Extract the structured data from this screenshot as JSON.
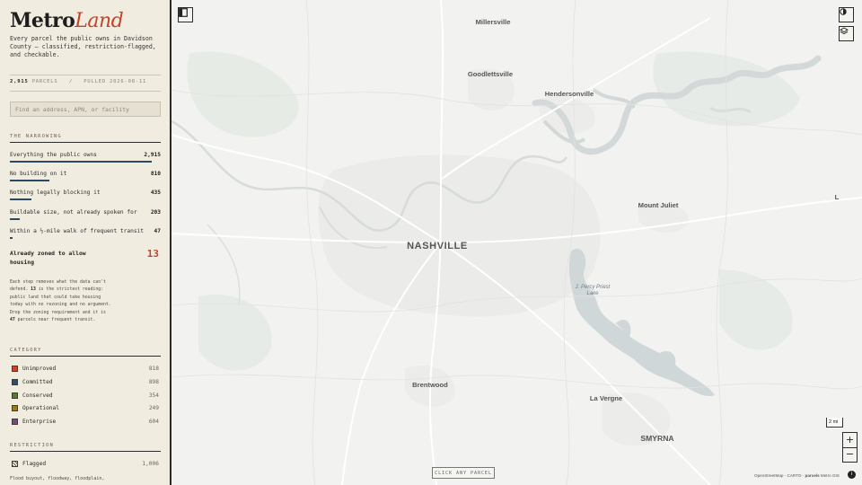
{
  "brand": {
    "part1": "Metro",
    "part2": "Land"
  },
  "tagline": "Every parcel the public owns in Davidson County — classified, restriction-flagged, and checkable.",
  "stats": {
    "count": "2,915",
    "count_label": "PARCELS",
    "separator": "/",
    "pulled": "PULLED 2026-08-11"
  },
  "search": {
    "placeholder": "Find an address, APN, or facility"
  },
  "narrowing": {
    "heading": "THE NARROWING",
    "steps": [
      {
        "label": "Everything the public owns",
        "count": "2,915",
        "fraction": 1.0
      },
      {
        "label": "No building on it",
        "count": "810",
        "fraction": 0.278
      },
      {
        "label": "Nothing legally blocking it",
        "count": "435",
        "fraction": 0.149
      },
      {
        "label": "Buildable size, not already spoken for",
        "count": "203",
        "fraction": 0.07
      },
      {
        "label": "Within a ½-mile walk of frequent transit",
        "count": "47",
        "fraction": 0.016
      }
    ],
    "final": {
      "label": "Already zoned to allow housing",
      "count": "13"
    },
    "note": {
      "part1": "Each step removes what the data can't defend.",
      "n1": "13",
      "part2": "is the strictest reading: public land that could take housing today with no rezoning and no argument. Drop the zoning requirement and it is",
      "n2": "47",
      "part3": "parcels near frequent transit."
    }
  },
  "category": {
    "heading": "CATEGORY",
    "items": [
      {
        "label": "Unimproved",
        "count": "818",
        "color": "#c9452b"
      },
      {
        "label": "Committed",
        "count": "898",
        "color": "#2f4f6f"
      },
      {
        "label": "Conserved",
        "count": "354",
        "color": "#5a7a3c"
      },
      {
        "label": "Operational",
        "count": "249",
        "color": "#9a7a24"
      },
      {
        "label": "Enterprise",
        "count": "604",
        "color": "#7a4a7e"
      }
    ]
  },
  "restriction": {
    "heading": "RESTRICTION",
    "flagged_label": "Flagged",
    "flagged_count": "1,006",
    "footnote": "Flood buyout, floodway, floodplain,"
  },
  "map": {
    "places": {
      "millersville": "Millersville",
      "goodlettsville": "Goodlettsville",
      "hendersonville": "Hendersonville",
      "mount_juliet": "Mount Juliet",
      "nashville": "NASHVILLE",
      "percy_priest_1": "J. Percy Priest",
      "percy_priest_2": "Lake",
      "brentwood": "Brentwood",
      "la_vergne": "La Vergne",
      "smyrna": "SMYRNA",
      "edge_letter": "L"
    },
    "scale_label": "2 mi",
    "zoom_in": "+",
    "zoom_out": "−",
    "hint": "CLICK ANY PARCEL",
    "attribution": {
      "osm": "OpenStreetMap",
      "carto": "CARTO",
      "sep": "·",
      "parcels": "parcels",
      "source": "Metro GIS"
    },
    "info": "i",
    "icons": {
      "sidebar_toggle": "sidebar-toggle-icon",
      "contrast": "contrast-icon",
      "layers": "layers-icon"
    }
  }
}
